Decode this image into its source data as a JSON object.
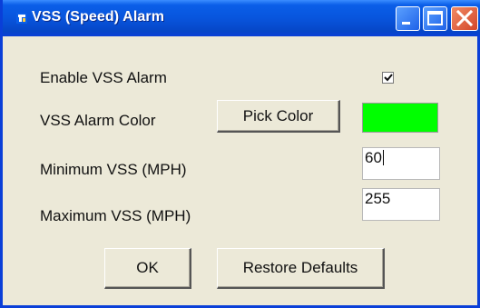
{
  "window": {
    "title": "VSS (Speed) Alarm",
    "app_icon": "app-icon",
    "controls": [
      "minimize-icon",
      "maximize-icon",
      "close-icon"
    ]
  },
  "form": {
    "enable_label": "Enable VSS Alarm",
    "enable_checked": true,
    "color_label": "VSS Alarm Color",
    "pick_color_label": "Pick Color",
    "alarm_color": "#00ff00",
    "min_label": "Minimum VSS (MPH)",
    "min_value": "60",
    "max_label": "Maximum VSS (MPH)",
    "max_value": "255"
  },
  "buttons": {
    "ok_label": "OK",
    "restore_label": "Restore Defaults"
  }
}
